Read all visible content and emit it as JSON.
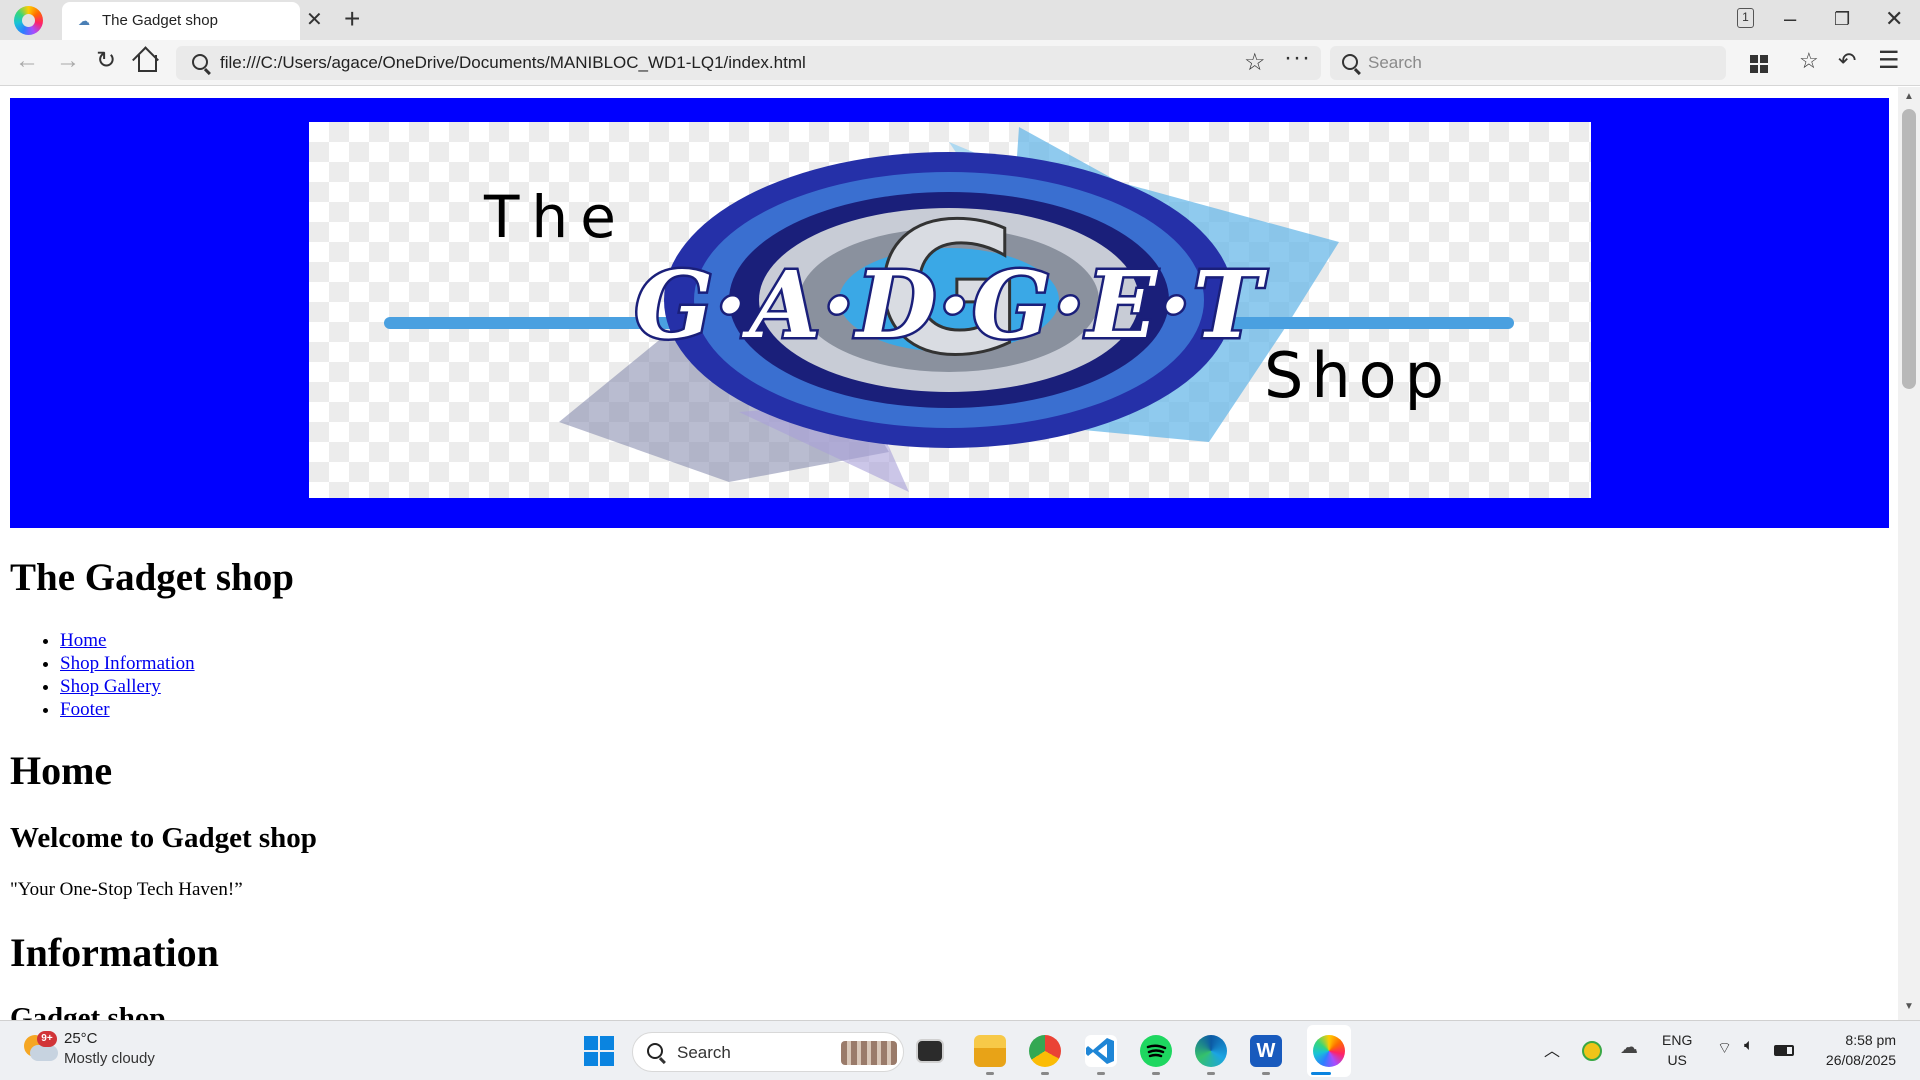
{
  "browser": {
    "tab_title": "The Gadget shop",
    "address": "file:///C:/Users/agace/OneDrive/Documents/MANIBLOC_WD1-LQ1/index.html",
    "search_placeholder": "Search",
    "tab_count": "1"
  },
  "page": {
    "logo_alt": "The G.A.D.G.E.T Shop",
    "logo_word_top": "The",
    "logo_word_main": "G·A·D·G·E·T",
    "logo_word_bottom": "Shop",
    "site_title": "The Gadget shop",
    "nav": [
      "Home",
      "Shop Information",
      "Shop Gallery",
      "Footer"
    ],
    "home_heading": "Home",
    "welcome_heading": "Welcome to Gadget shop",
    "tagline": "\"Your One-Stop Tech Haven!”",
    "info_heading": "Information",
    "info_subheading": "Gadget shop"
  },
  "colors": {
    "banner": "#0000ff",
    "link": "#0000ee"
  },
  "taskbar": {
    "weather_temp": "25°C",
    "weather_desc": "Mostly cloudy",
    "weather_badge": "9+",
    "search_label": "Search",
    "language_top": "ENG",
    "language_bottom": "US",
    "time": "8:58 pm",
    "date": "26/08/2025",
    "apps": [
      "file-explorer",
      "chrome",
      "vscode",
      "spotify",
      "edge",
      "word",
      "browser"
    ]
  }
}
